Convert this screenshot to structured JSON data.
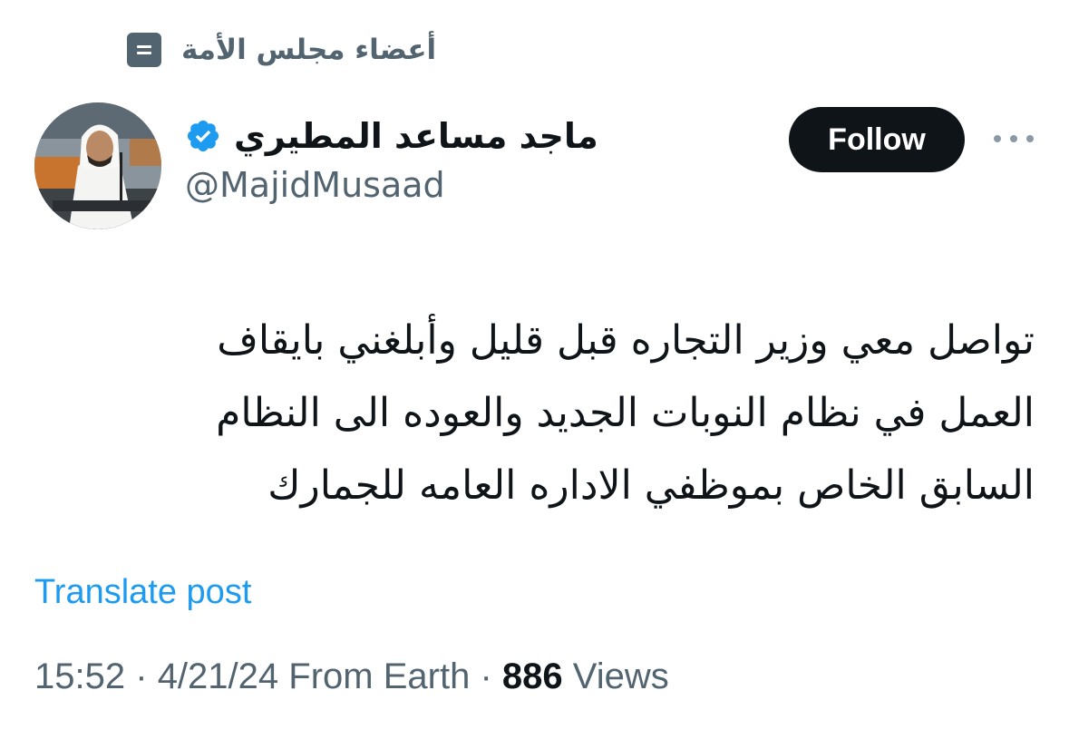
{
  "context": {
    "label": "أعضاء مجلس الأمة",
    "icon": "list-icon"
  },
  "author": {
    "display_name": "ماجد مساعد المطيري",
    "handle": "@MajidMusaad",
    "verified": true,
    "verified_icon": "verified-badge-icon",
    "verified_color": "#1d9bf0",
    "avatar": "profile-photo"
  },
  "actions": {
    "follow_label": "Follow",
    "more_icon": "more-horizontal-icon"
  },
  "post": {
    "lines": [
      "تواصل معي وزير التجاره قبل قليل وأبلغني بايقاف",
      "العمل في نظام النوبات الجديد والعوده الى النظام",
      "السابق الخاص بموظفي الاداره العامه للجمارك"
    ],
    "translate_label": "Translate post"
  },
  "meta": {
    "time": "15:52",
    "separator": "·",
    "date": "4/21/24",
    "source": "From Earth",
    "views_count": "886",
    "views_label": "Views"
  },
  "colors": {
    "text": "#0f1419",
    "secondary": "#536471",
    "link": "#1d9bf0",
    "button": "#0f1419"
  }
}
